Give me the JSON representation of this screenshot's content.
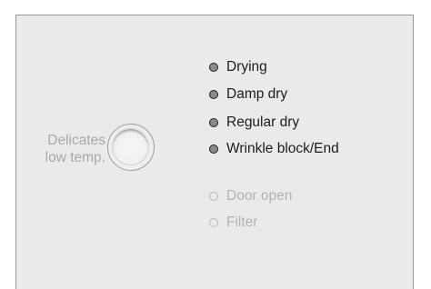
{
  "program_knob": {
    "label_line1": "Delicates",
    "label_line2": "low temp."
  },
  "status_indicators": [
    {
      "label": "Drying",
      "state": "on"
    },
    {
      "label": "Damp dry",
      "state": "on"
    },
    {
      "label": "Regular dry",
      "state": "on"
    },
    {
      "label": "Wrinkle block/End",
      "state": "on"
    }
  ],
  "warning_indicators": [
    {
      "label": "Door open",
      "state": "off"
    },
    {
      "label": "Filter",
      "state": "off"
    }
  ]
}
